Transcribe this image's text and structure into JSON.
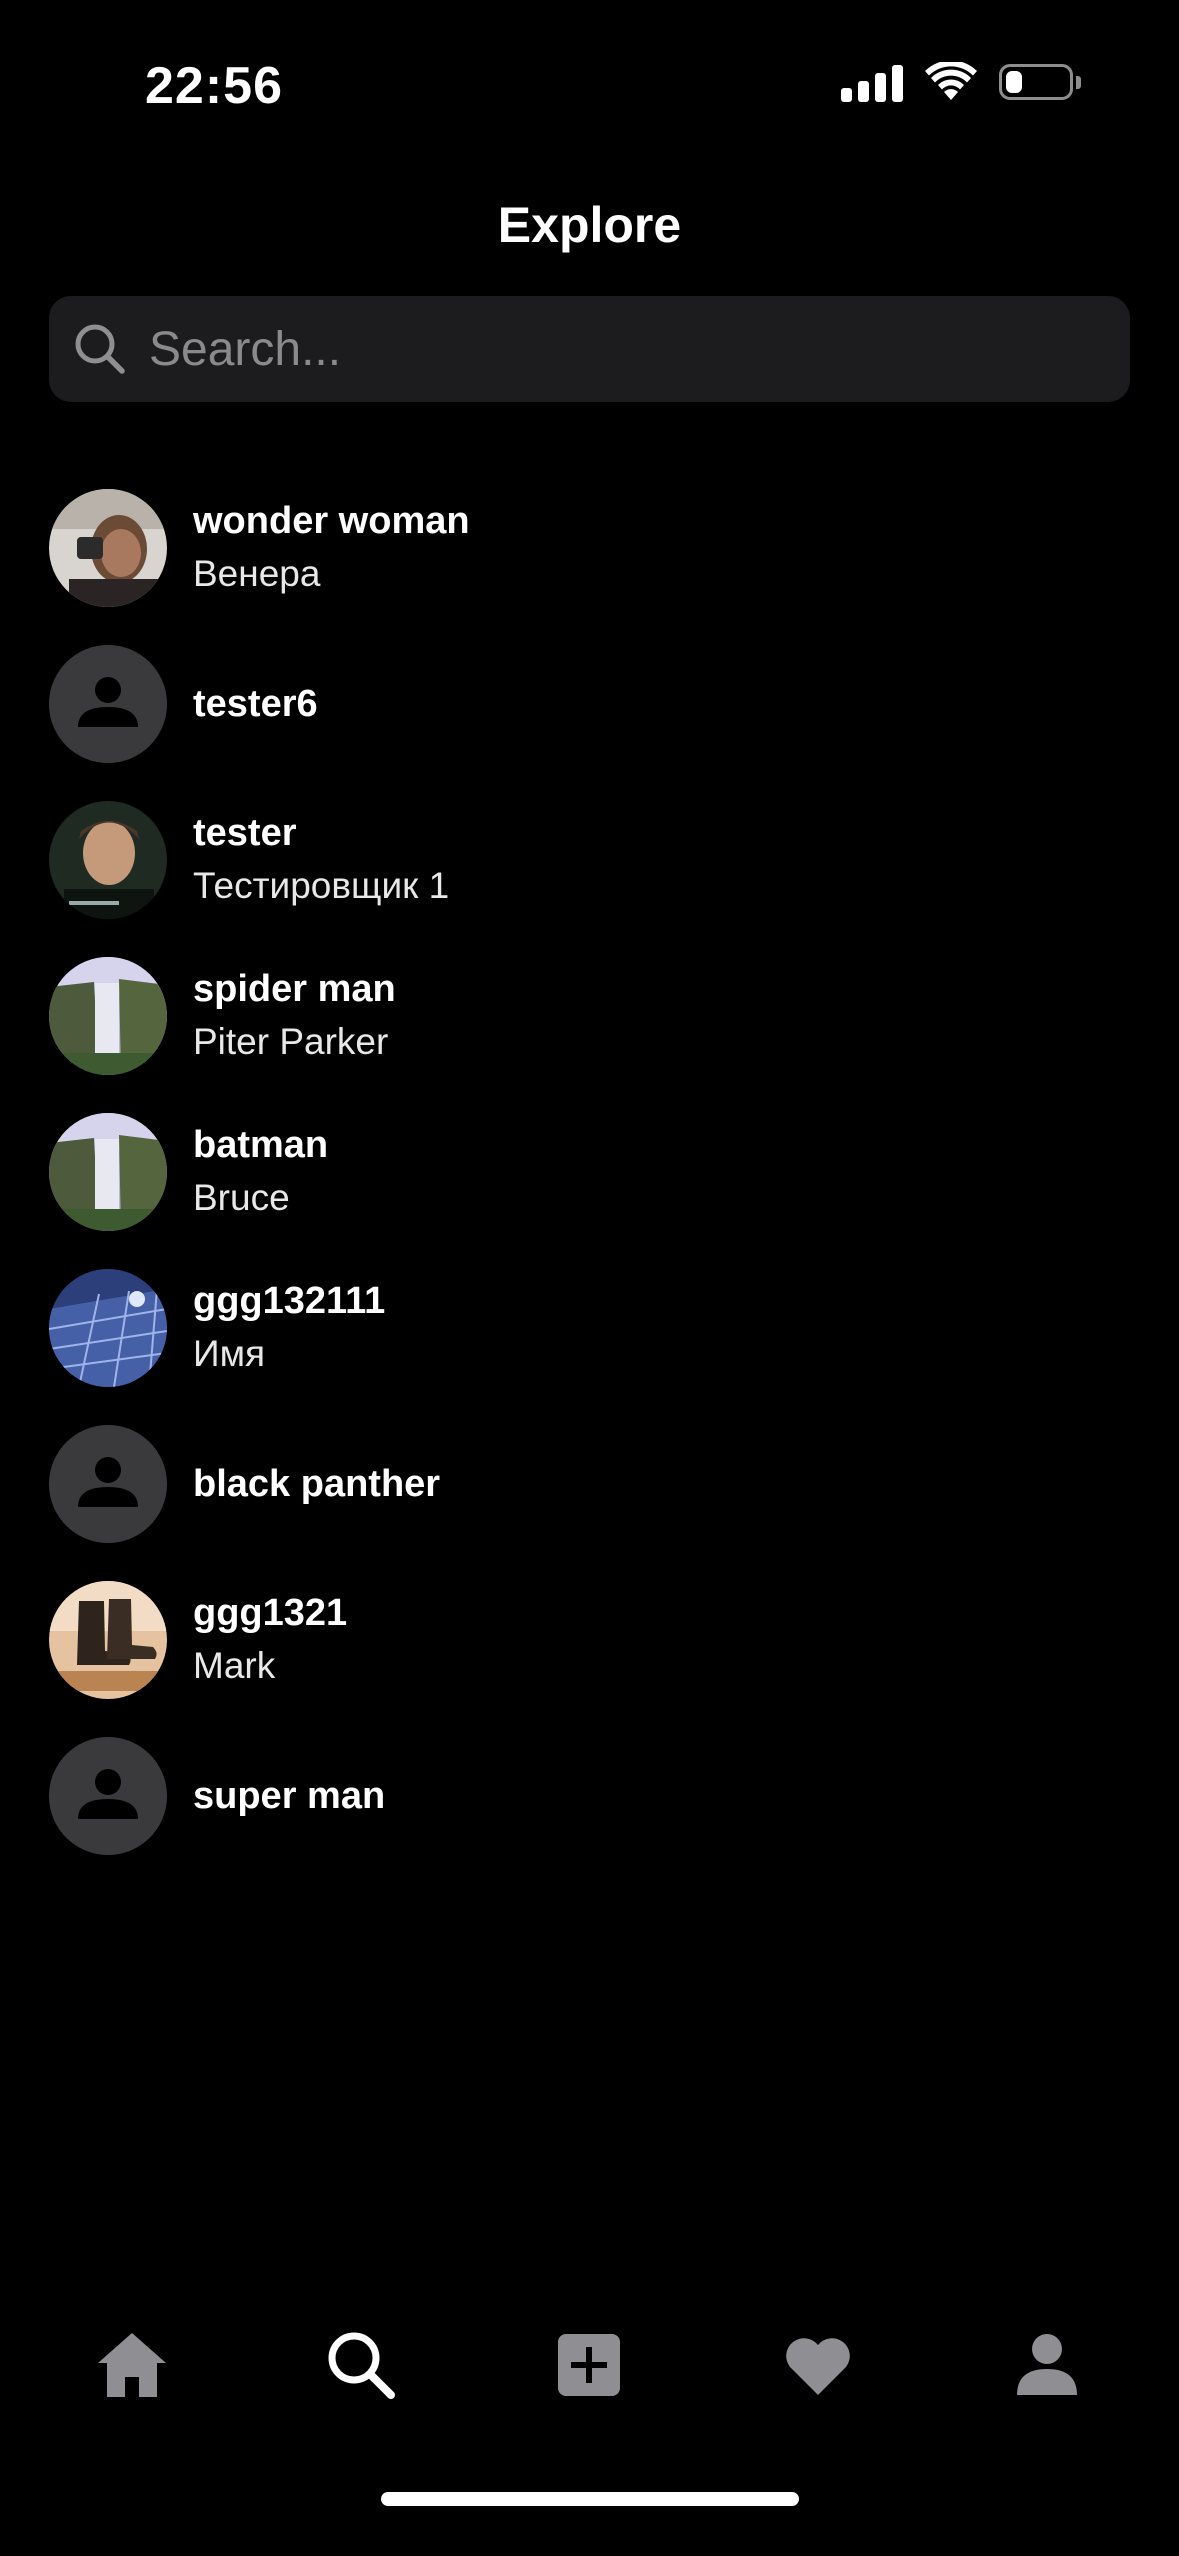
{
  "status_bar": {
    "time": "22:56",
    "battery_level": 0.25
  },
  "header": {
    "title": "Explore"
  },
  "search": {
    "placeholder": "Search...",
    "value": ""
  },
  "users": [
    {
      "username": "wonder woman",
      "fullname": "Венера",
      "avatar": "photo-woman"
    },
    {
      "username": "tester6",
      "fullname": "",
      "avatar": "placeholder"
    },
    {
      "username": "tester",
      "fullname": "Тестировщик 1",
      "avatar": "photo-man"
    },
    {
      "username": "spider man",
      "fullname": "Piter Parker",
      "avatar": "photo-waterfall"
    },
    {
      "username": "batman",
      "fullname": "Bruce",
      "avatar": "photo-waterfall"
    },
    {
      "username": "ggg132111",
      "fullname": "Имя",
      "avatar": "photo-building"
    },
    {
      "username": "black panther",
      "fullname": "",
      "avatar": "placeholder"
    },
    {
      "username": "ggg1321",
      "fullname": "Mark",
      "avatar": "photo-boots"
    },
    {
      "username": "super man",
      "fullname": "",
      "avatar": "placeholder"
    }
  ],
  "tab_bar": {
    "items": [
      {
        "icon": "home-icon",
        "active": false
      },
      {
        "icon": "search-icon",
        "active": true
      },
      {
        "icon": "plus-square-icon",
        "active": false
      },
      {
        "icon": "heart-icon",
        "active": false
      },
      {
        "icon": "profile-icon",
        "active": false
      }
    ]
  },
  "colors": {
    "background": "#000000",
    "search_bg": "#1c1c1e",
    "placeholder_avatar": "#3a3a3c",
    "inactive_icon": "#8e8e93",
    "active_icon": "#ffffff"
  }
}
